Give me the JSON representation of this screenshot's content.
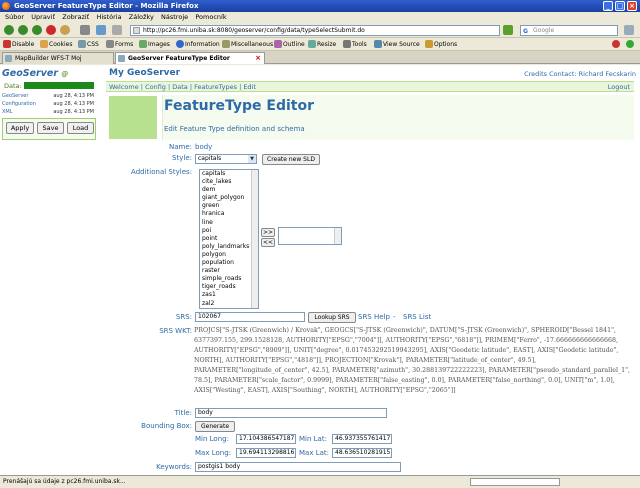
{
  "window": {
    "title": "GeoServer FeatureType Editor - Mozilla Firefox"
  },
  "menu": [
    "Súbor",
    "Upraviť",
    "Zobraziť",
    "História",
    "Záložky",
    "Nástroje",
    "Pomocník"
  ],
  "nav": {
    "url": "http://pc26.fmi.uniba.sk:8080/geoserver/config/data/typeSelectSubmit.do",
    "search_placeholder": "Google"
  },
  "devbar": [
    "Disable",
    "Cookies",
    "CSS",
    "Forms",
    "Images",
    "Information",
    "Miscellaneous",
    "Outline",
    "Resize",
    "Tools",
    "View Source",
    "Options"
  ],
  "tabs": [
    {
      "label": "MapBuilder WFS-T Moj",
      "active": false
    },
    {
      "label": "GeoServer FeatureType Editor",
      "active": true
    }
  ],
  "sidebar": {
    "logo": "GeoServer",
    "data_label": "Data:",
    "status": [
      {
        "name": "GeoServer",
        "date": "aug 28, 4:13 PM"
      },
      {
        "name": "Configuration",
        "date": "aug 28, 4:13 PM"
      },
      {
        "name": "XML",
        "date": "aug 28, 4:13 PM"
      }
    ],
    "buttons": {
      "apply": "Apply",
      "save": "Save",
      "load": "Load"
    }
  },
  "header": {
    "title": "My GeoServer",
    "credits": "Credits",
    "contact": "Contact: Richard Fecskarin",
    "nav": [
      "Welcome",
      "Config",
      "Data",
      "FeatureTypes",
      "Edit"
    ],
    "logout": "Logout"
  },
  "editor": {
    "title": "FeatureType Editor",
    "subtitle": "Edit Feature Type definition and schema",
    "name_label": "Name:",
    "name_value": "body",
    "style_label": "Style:",
    "style_value": "capitals",
    "create_sld": "Create new SLD",
    "additional_styles_label": "Additional Styles:",
    "styles": [
      "capitals",
      "cite_lakes",
      "dem",
      "giant_polygon",
      "green",
      "hranica",
      "line",
      "poi",
      "point",
      "poly_landmarks",
      "polygon",
      "population",
      "raster",
      "simple_roads",
      "tiger_roads",
      "zas1",
      "zal2"
    ],
    "move_right": ">>",
    "move_left": "<<",
    "srs_label": "SRS:",
    "srs_value": "102067",
    "lookup_srs": "Lookup SRS",
    "srs_help": "SRS Help",
    "srs_sep": "-",
    "srs_list": "SRS List",
    "wkt_label": "SRS WKT:",
    "wkt": "PROJCS[\"S-JTSK (Greenwich) / Krovak\", GEOGCS[\"S-JTSK (Greenwich)\", DATUM[\"S-JTSK (Greenwich)\", SPHEROID[\"Bessel 1841\", 6377397.155, 299.1528128, AUTHORITY[\"EPSG\",\"7004\"]], AUTHORITY[\"EPSG\",\"6818\"]], PRIMEM[\"Ferro\", -17.666666666666668, AUTHORITY[\"EPSG\",\"8909\"]], UNIT[\"degree\", 0.017453292519943295], AXIS[\"Geodetic latitude\", EAST], AXIS[\"Geodetic latitude\", NORTH], AUTHORITY[\"EPSG\",\"4818\"]], PROJECTION[\"Krovak\"], PARAMETER[\"latitude_of_center\", 49.5], PARAMETER[\"longitude_of_center\", 42.5], PARAMETER[\"azimuth\", 30.288139722222223], PARAMETER[\"pseudo_standard_parallel_1\", 78.5], PARAMETER[\"scale_factor\", 0.9999], PARAMETER[\"false_easting\", 0.0], PARAMETER[\"false_northing\", 0.0], UNIT[\"m\", 1.0], AXIS[\"Westing\", EAST], AXIS[\"Southing\", NORTH], AUTHORITY[\"EPSG\",\"2065\"]]",
    "title_label": "Title:",
    "title_value": "body",
    "bbox_label": "Bounding Box:",
    "generate": "Generate",
    "min_long_label": "Min Long:",
    "min_long": "17.104386547187",
    "min_lat_label": "Min Lat:",
    "min_lat": "46.937355761417",
    "max_long_label": "Max Long:",
    "max_long": "19.694113298816",
    "max_lat_label": "Max Lat:",
    "max_lat": "48.636510281915",
    "keywords_label": "Keywords:",
    "keywords": "postgis1 body"
  },
  "statusbar": {
    "text": "Prenášajú sa údaje z pc26.fmi.uniba.sk..."
  }
}
